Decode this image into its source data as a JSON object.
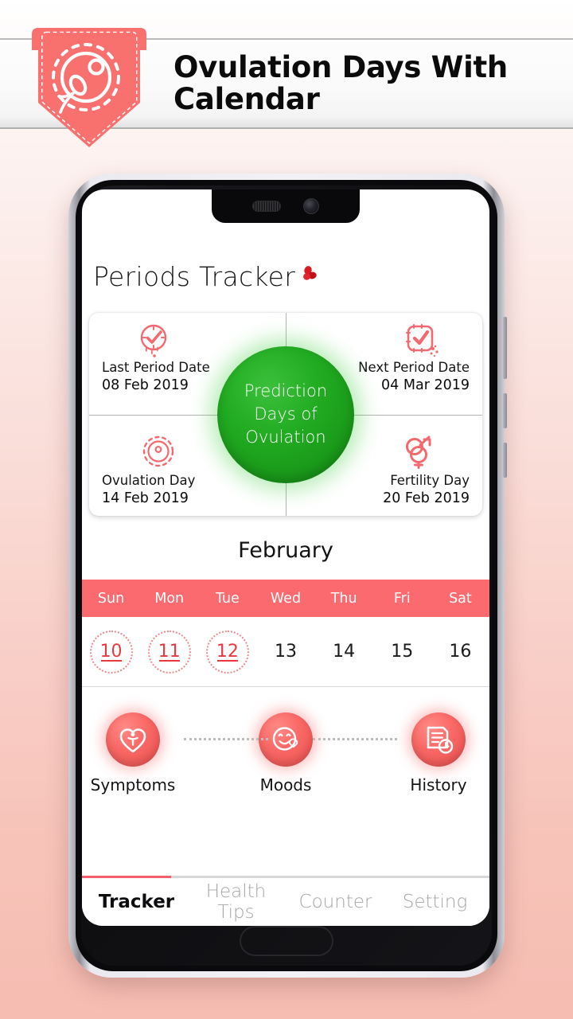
{
  "header": {
    "title": "Ovulation Days  With Calendar",
    "logo_icon": "ovum-sperm-icon"
  },
  "app": {
    "title": "Periods Tracker",
    "title_icon": "three-petal-flower-icon",
    "prediction_card": {
      "center_line1": "Prediction",
      "center_line2": "Days of",
      "center_line3": "Ovulation",
      "center_color": "#22ac22",
      "quadrants": [
        {
          "icon": "clock-check-drip-icon",
          "label": "Last Period Date",
          "date": "08 Feb 2019"
        },
        {
          "icon": "calendar-check-icon",
          "label": "Next Period Date",
          "date": "04 Mar 2019"
        },
        {
          "icon": "ovum-icon",
          "label": "Ovulation Day",
          "date": "14 Feb 2019"
        },
        {
          "icon": "gender-symbols-icon",
          "label": "Fertility Day",
          "date": "20 Feb 2019"
        }
      ]
    },
    "calendar": {
      "month": "February",
      "accent_color": "#fa6a6f",
      "weekdays": [
        "Sun",
        "Mon",
        "Tue",
        "Wed",
        "Thu",
        "Fri",
        "Sat"
      ],
      "days": [
        {
          "num": "10",
          "marked": true
        },
        {
          "num": "11",
          "marked": true
        },
        {
          "num": "12",
          "marked": true
        },
        {
          "num": "13",
          "marked": false
        },
        {
          "num": "14",
          "marked": false
        },
        {
          "num": "15",
          "marked": false
        },
        {
          "num": "16",
          "marked": false
        }
      ]
    },
    "actions": [
      {
        "icon": "heart-person-icon",
        "label": "Symptoms"
      },
      {
        "icon": "smiley-heart-icon",
        "label": "Moods"
      },
      {
        "icon": "document-clock-icon",
        "label": "History"
      }
    ],
    "tabs": [
      {
        "label": "Tracker",
        "active": true
      },
      {
        "label": "Health Tips",
        "active": false
      },
      {
        "label": "Counter",
        "active": false
      },
      {
        "label": "Setting",
        "active": false
      }
    ]
  }
}
